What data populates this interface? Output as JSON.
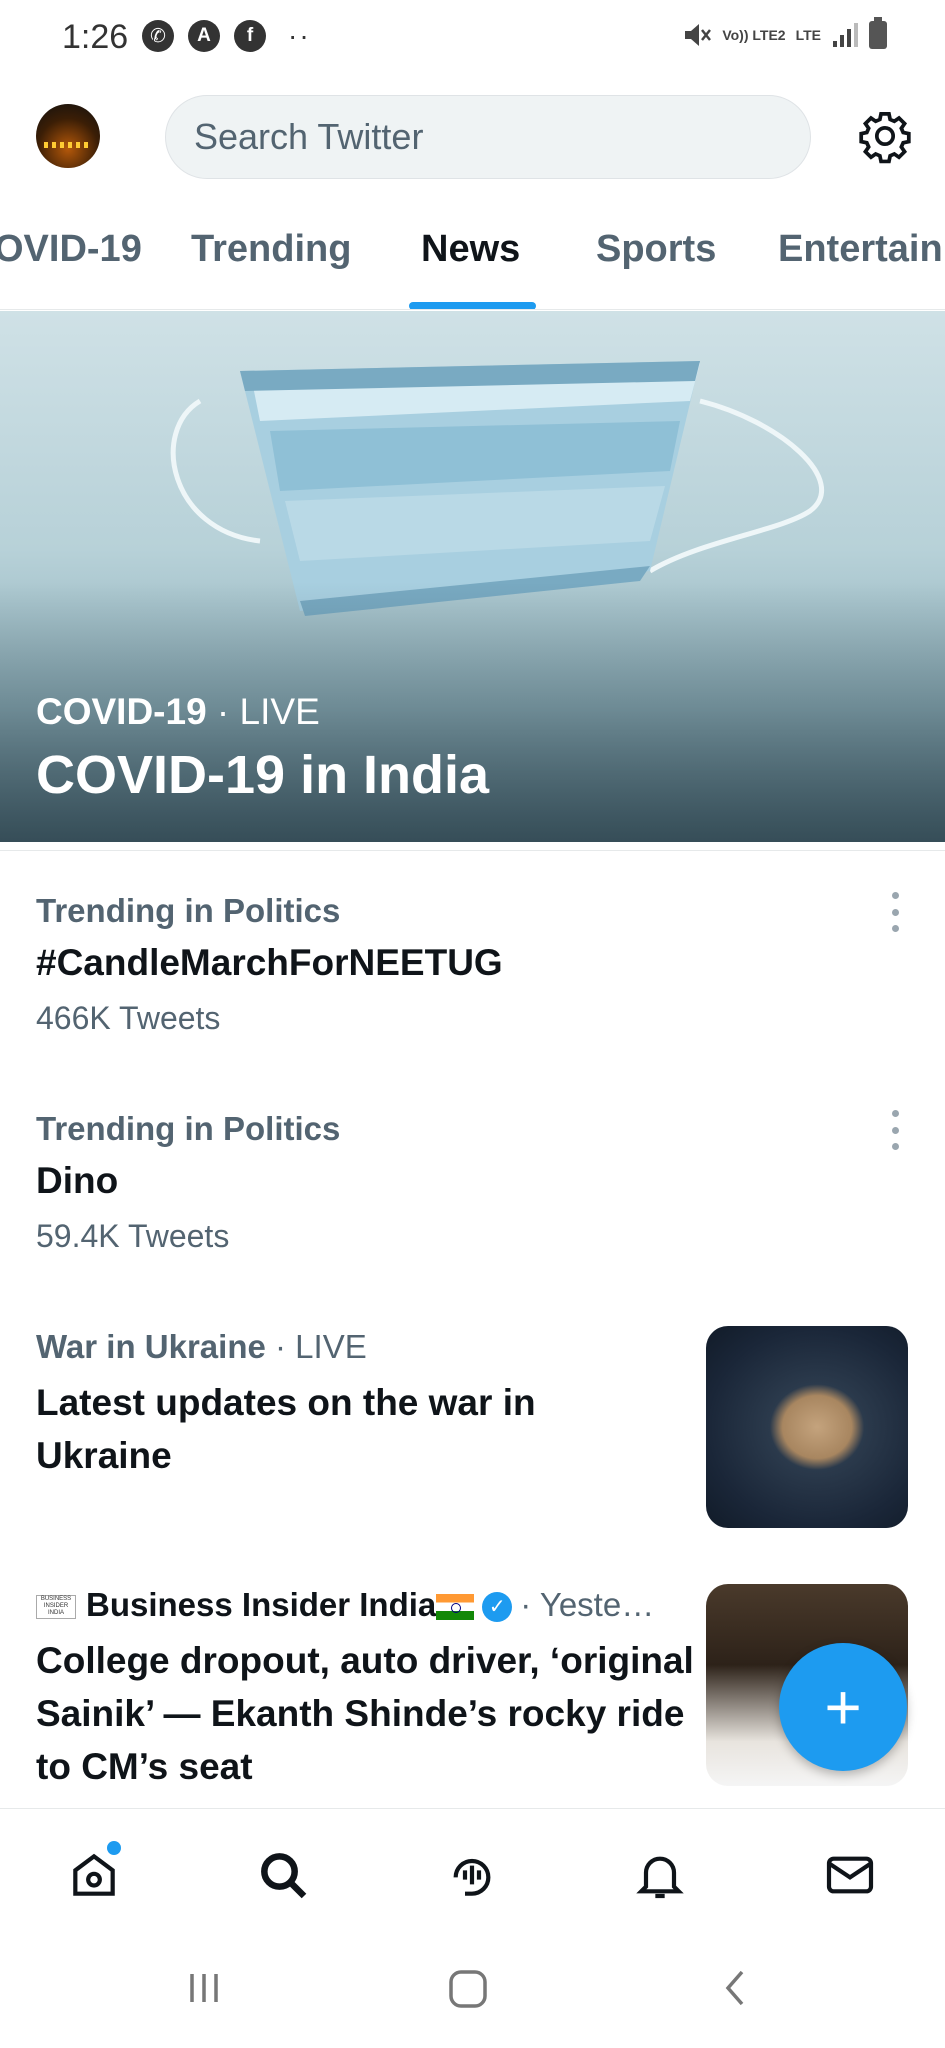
{
  "status_bar": {
    "time": "1:26",
    "network": "Vo)) LTE2",
    "lte": "LTE"
  },
  "header": {
    "search_placeholder": "Search Twitter"
  },
  "tabs": [
    {
      "label": "OVID-19",
      "active": false
    },
    {
      "label": "Trending",
      "active": false
    },
    {
      "label": "News",
      "active": true
    },
    {
      "label": "Sports",
      "active": false
    },
    {
      "label": "Entertain",
      "active": false
    }
  ],
  "hero": {
    "category": "COVID-19",
    "separator": " · ",
    "status": "LIVE",
    "title": "COVID-19 in India"
  },
  "trends": [
    {
      "context": "Trending in Politics",
      "name": "#CandleMarchForNEETUG",
      "count": "466K Tweets"
    },
    {
      "context": "Trending in Politics",
      "name": "Dino",
      "count": "59.4K Tweets"
    }
  ],
  "news": [
    {
      "context": "War in Ukraine",
      "status": "LIVE",
      "headline": "Latest updates on the war in Ukraine"
    },
    {
      "source": "Business Insider India",
      "time": "· Yeste…",
      "headline": "College dropout, auto driver, ‘original Sainik’ — Ekanth Shinde’s rocky ride to CM’s seat",
      "logo_text": "BUSINESS INSIDER INDIA"
    }
  ],
  "fab": {
    "label": "+"
  },
  "colors": {
    "accent": "#1d9bf0",
    "text": "#0f1419",
    "secondary": "#536471"
  },
  "bottom_nav": [
    "home-icon",
    "search-icon",
    "spaces-icon",
    "notifications-icon",
    "messages-icon"
  ]
}
